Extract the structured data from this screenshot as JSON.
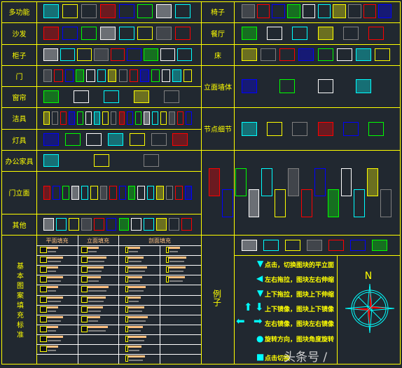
{
  "left_categories": [
    "多功能",
    "沙发",
    "柜子",
    "门",
    "窗帘",
    "洁具",
    "灯具",
    "办公家具",
    "门立面",
    "其他"
  ],
  "right_categories": [
    "椅子",
    "餐厅",
    "床",
    "立面墙体",
    "节点细节"
  ],
  "fill_standard": {
    "title": "基本图案填充标准",
    "headers": [
      "平面填充",
      "立面填充",
      "剖面填充"
    ]
  },
  "example": {
    "title": "例子",
    "instructions": [
      "点击，切换图块的平立面",
      "左右拖拉，图块左右伸缩",
      "上下拖拉，图块上下伸缩",
      "上下镜像，图块上下镜像",
      "左右镜像，图块左右镜像",
      "旋转方向，图块角度旋转",
      "点击切换"
    ],
    "compass_label": "N"
  },
  "watermark": "头条号 / ",
  "colors": {
    "grid": "#ffff00",
    "background": "#212830",
    "accent": "#00ffff",
    "fill_bar": "#ffc080",
    "gray": "#808080"
  }
}
